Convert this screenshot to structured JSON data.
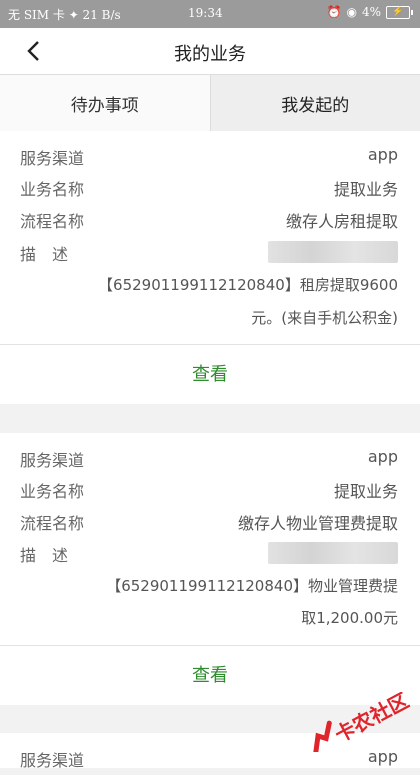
{
  "status_bar": {
    "left": "无 SIM 卡 ✦ 21 B/s",
    "time": "19:34",
    "battery": "4%"
  },
  "header": {
    "title": "我的业务"
  },
  "tabs": [
    {
      "label": "待办事项",
      "selected": false
    },
    {
      "label": "我发起的",
      "selected": true
    }
  ],
  "labels": {
    "channel": "服务渠道",
    "business": "业务名称",
    "process": "流程名称",
    "description": "描　述"
  },
  "records": [
    {
      "channel": "app",
      "business": "提取业务",
      "process": "缴存人房租提取",
      "desc_line1": "【652901199112120840】租房提取9600",
      "desc_line2": "元。(来自手机公积金)",
      "view": "查看"
    },
    {
      "channel": "app",
      "business": "提取业务",
      "process": "缴存人物业管理费提取",
      "desc_line1": "【652901199112120840】物业管理费提",
      "desc_line2": "取1,200.00元",
      "view": "查看"
    },
    {
      "channel": "app"
    }
  ],
  "watermark": "卡农社区",
  "colors": {
    "accent": "#2e8b2e",
    "watermark": "#e0242c"
  }
}
